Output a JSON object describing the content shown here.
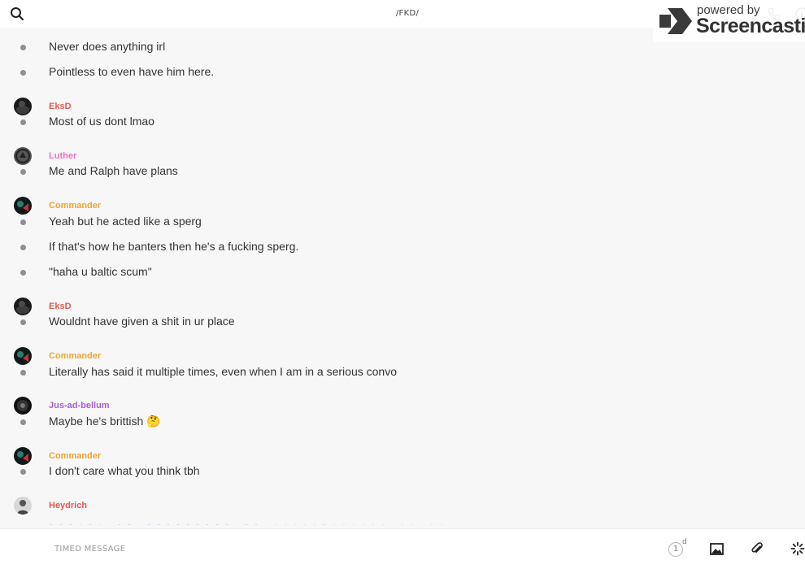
{
  "header": {
    "channel_title": "/FKD/",
    "search_icon": "search-icon",
    "phone_icon": "phone-icon",
    "info_icon": "info-icon"
  },
  "watermark": {
    "powered_by": "powered by",
    "brand": "Screencastify"
  },
  "feed": {
    "messages": [
      "Never does anything irl",
      "Pointless to even have him here.",
      "Most of us dont lmao",
      "Me and Ralph have plans",
      "Yeah but he acted like a sperg",
      "If that's how he banters then he's a fucking sperg.",
      "\"haha u baltic scum\"",
      "Wouldnt have given a shit in ur place",
      "Literally has said it multiple times, even when I am in a serious convo",
      "Maybe he's brittish 🤔",
      "I don't care what you think tbh"
    ],
    "authors": [
      {
        "name": "EksD",
        "color": "#e05a4f"
      },
      {
        "name": "Luther",
        "color": "#e772c4"
      },
      {
        "name": "Commander",
        "color": "#f0a433"
      },
      {
        "name": "EksD",
        "color": "#e05a4f"
      },
      {
        "name": "Commander",
        "color": "#f0a433"
      },
      {
        "name": "Jus-ad-bellum",
        "color": "#a75bd6"
      },
      {
        "name": "Commander",
        "color": "#f0a433"
      },
      {
        "name": "Heydrich",
        "color": "#e05a4f"
      }
    ]
  },
  "composer": {
    "placeholder": "TIMED MESSAGE",
    "timer_value": "1",
    "timer_unit": "d",
    "image_icon": "image-icon",
    "attach_icon": "paperclip-icon",
    "spinner_icon": "spinner-icon"
  }
}
